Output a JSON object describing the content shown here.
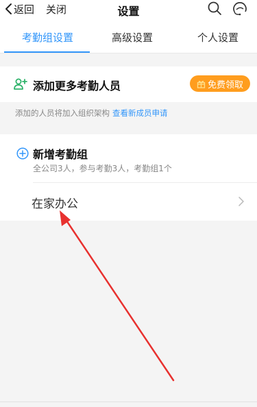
{
  "navbar": {
    "back_label": "返回",
    "close_label": "关闭",
    "title": "设置"
  },
  "tabs": [
    {
      "label": "考勤组设置",
      "active": true
    },
    {
      "label": "高级设置",
      "active": false
    },
    {
      "label": "个人设置",
      "active": false
    }
  ],
  "add_members": {
    "label": "添加更多考勤人员",
    "button_label": "免费领取",
    "hint": "添加的人员将加入组织架构",
    "hint_link": "查看新成员申请"
  },
  "groups": {
    "new_group_label": "新增考勤组",
    "summary": "全公司3人，参与考勤3人，考勤组1个",
    "items": [
      {
        "name": "在家办公"
      }
    ]
  },
  "colors": {
    "accent": "#3296fa",
    "orange": "#ff9d1e",
    "annotation_arrow": "#e8312f"
  },
  "icons": {
    "back": "chevron-left-icon",
    "search": "search-icon",
    "help": "help-icon",
    "add_user": "add-user-icon",
    "add": "plus-circle-icon",
    "gift": "gift-icon",
    "chevron": "chevron-right-icon"
  }
}
